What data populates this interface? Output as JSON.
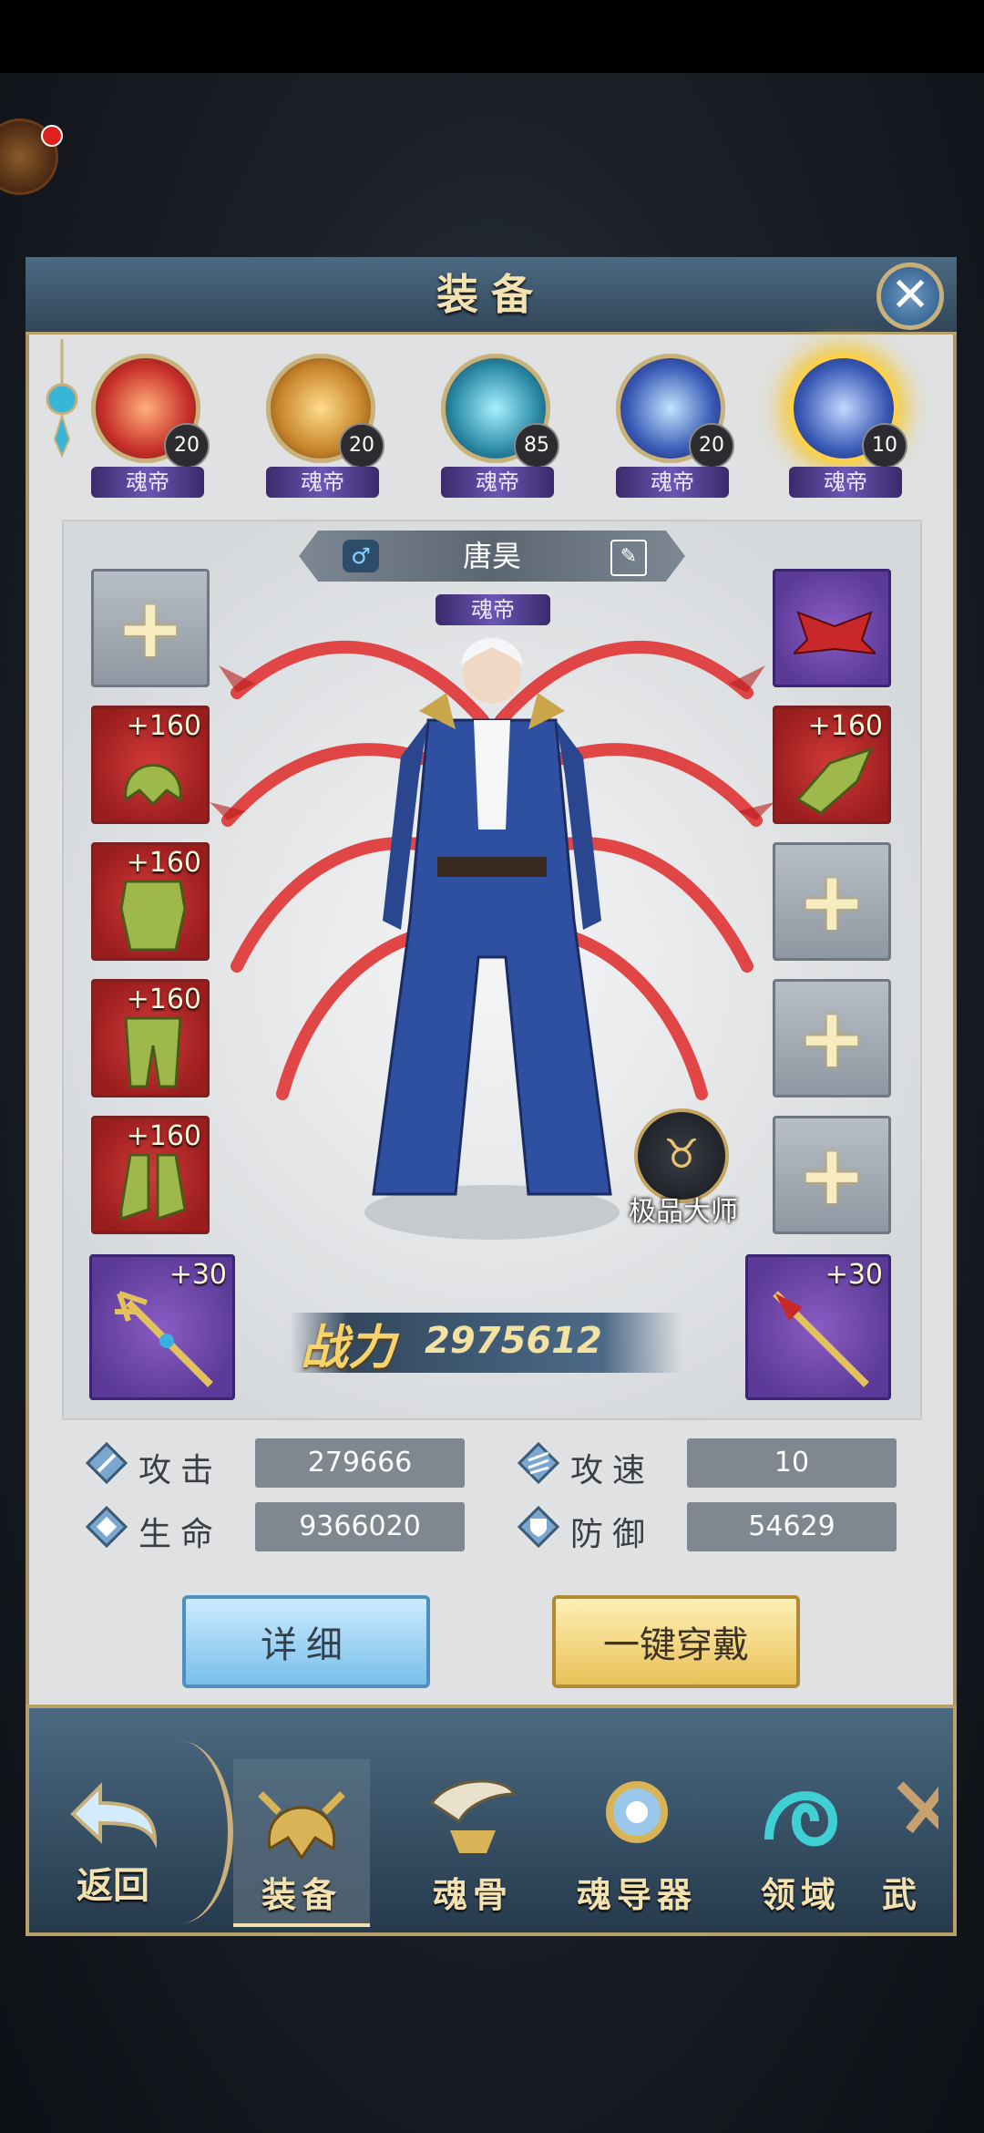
{
  "header": {
    "title": "装备",
    "close_icon": "close-icon"
  },
  "spirits": [
    {
      "level": "20",
      "rank": "魂帝",
      "icon": "phoenix-spirit-icon",
      "color": "#d0402a"
    },
    {
      "level": "20",
      "rank": "魂帝",
      "icon": "bear-spirit-icon",
      "color": "#c98a2a"
    },
    {
      "level": "85",
      "rank": "魂帝",
      "icon": "tower-spirit-icon",
      "color": "#2a8aa6"
    },
    {
      "level": "20",
      "rank": "魂帝",
      "icon": "lotus-spirit-icon",
      "color": "#3a5ab6"
    },
    {
      "level": "10",
      "rank": "魂帝",
      "icon": "hammer-spirit-icon",
      "color": "#3a5ab6",
      "selected": true
    }
  ],
  "character": {
    "gender_icon": "male-icon",
    "name": "唐昊",
    "rank": "魂帝",
    "badge": "极品大师"
  },
  "equipment": {
    "left": [
      {
        "type": "empty"
      },
      {
        "type": "red",
        "enhance": "+160",
        "icon": "helmet-icon"
      },
      {
        "type": "red",
        "enhance": "+160",
        "icon": "armor-icon"
      },
      {
        "type": "red",
        "enhance": "+160",
        "icon": "leggings-icon"
      },
      {
        "type": "red",
        "enhance": "+160",
        "icon": "boots-icon"
      },
      {
        "type": "purple",
        "enhance": "+30",
        "icon": "trident-icon"
      }
    ],
    "right": [
      {
        "type": "purple",
        "icon": "wings-icon"
      },
      {
        "type": "red",
        "enhance": "+160",
        "icon": "gauntlet-icon"
      },
      {
        "type": "empty"
      },
      {
        "type": "empty"
      },
      {
        "type": "empty"
      },
      {
        "type": "purple",
        "enhance": "+30",
        "icon": "spear-icon"
      }
    ]
  },
  "power": {
    "label": "战力",
    "value": "2975612"
  },
  "stats": [
    {
      "label": "攻击",
      "value": "279666"
    },
    {
      "label": "攻速",
      "value": "10"
    },
    {
      "label": "生命",
      "value": "9366020"
    },
    {
      "label": "防御",
      "value": "54629"
    }
  ],
  "buttons": {
    "detail": "详细",
    "equip_all": "一键穿戴"
  },
  "nav": {
    "back": "返回",
    "tabs": [
      "装备",
      "魂骨",
      "魂导器",
      "领域",
      "武"
    ]
  }
}
